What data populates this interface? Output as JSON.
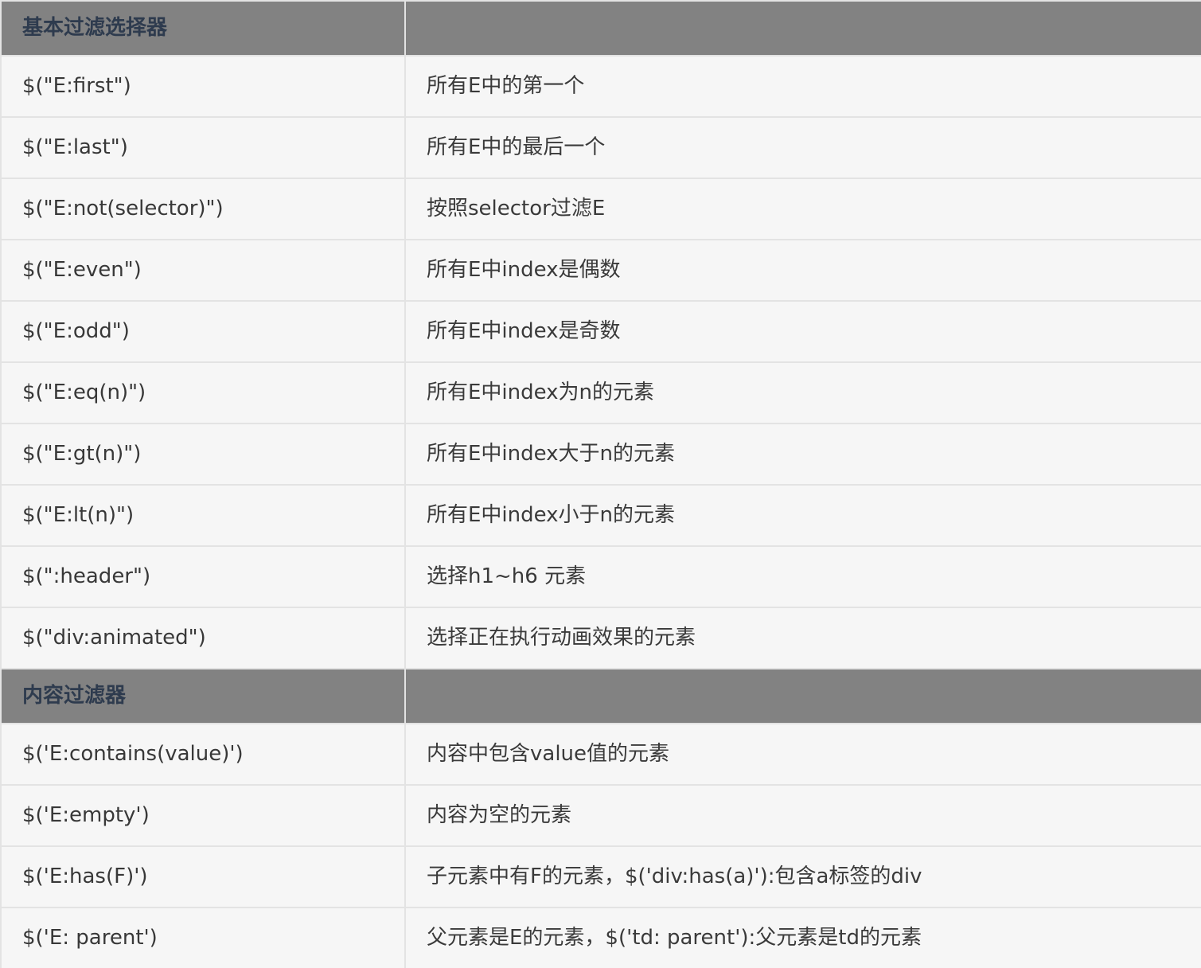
{
  "groups": [
    {
      "title": "基本过滤选择器",
      "rows": [
        {
          "selector": "$(\"E:first\")",
          "desc": "所有E中的第一个"
        },
        {
          "selector": "$(\"E:last\")",
          "desc": "所有E中的最后一个"
        },
        {
          "selector": "$(\"E:not(selector)\")",
          "desc": "按照selector过滤E"
        },
        {
          "selector": "$(\"E:even\")",
          "desc": "所有E中index是偶数"
        },
        {
          "selector": "$(\"E:odd\")",
          "desc": "所有E中index是奇数"
        },
        {
          "selector": "$(\"E:eq(n)\")",
          "desc": "所有E中index为n的元素"
        },
        {
          "selector": "$(\"E:gt(n)\")",
          "desc": "所有E中index大于n的元素"
        },
        {
          "selector": "$(\"E:lt(n)\")",
          "desc": "所有E中index小于n的元素"
        },
        {
          "selector": "$(\":header\")",
          "desc": "选择h1~h6 元素"
        },
        {
          "selector": "$(\"div:animated\")",
          "desc": "选择正在执行动画效果的元素"
        }
      ]
    },
    {
      "title": "内容过滤器",
      "rows": [
        {
          "selector": "$('E:contains(value)')",
          "desc": "内容中包含value值的元素"
        },
        {
          "selector": "$('E:empty')",
          "desc": "内容为空的元素"
        },
        {
          "selector": "$('E:has(F)')",
          "desc": "子元素中有F的元素，$('div:has(a)'):包含a标签的div"
        },
        {
          "selector": "$('E: parent')",
          "desc": "父元素是E的元素，$('td: parent'):父元素是td的元素"
        }
      ]
    }
  ]
}
